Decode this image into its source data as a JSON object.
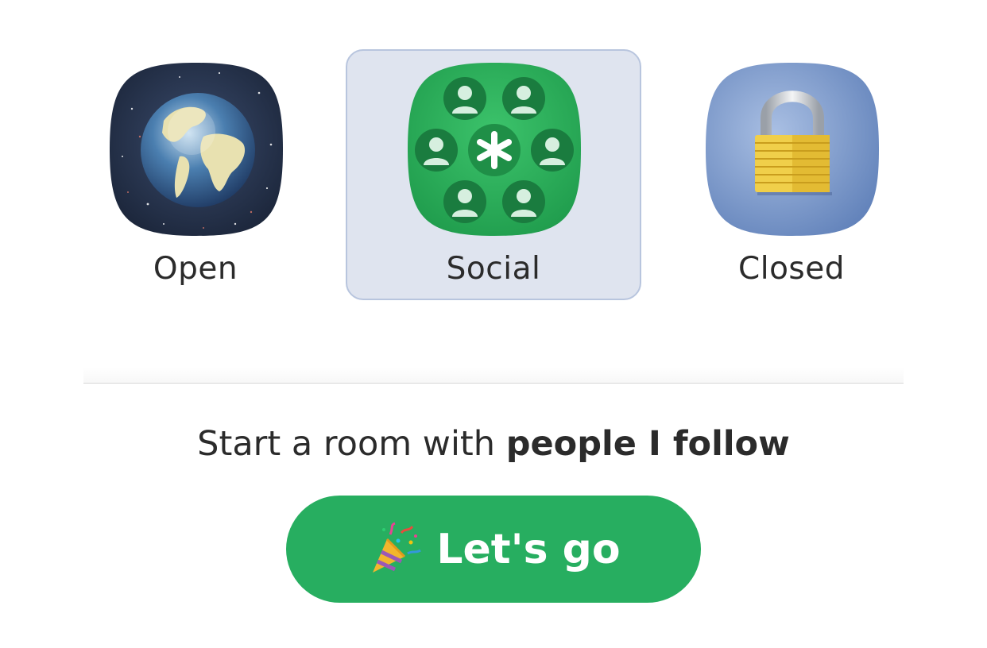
{
  "room_types": [
    {
      "id": "open",
      "label": "Open",
      "icon": "globe-icon",
      "selected": false
    },
    {
      "id": "social",
      "label": "Social",
      "icon": "social-group-icon",
      "selected": true
    },
    {
      "id": "closed",
      "label": "Closed",
      "icon": "padlock-icon",
      "selected": false
    }
  ],
  "prompt": {
    "prefix": "Start a room with ",
    "emphasis": "people I follow"
  },
  "go_button": {
    "label": "Let's go",
    "icon": "party-popper-icon",
    "color": "#27ae60"
  },
  "colors": {
    "selected_bg": "#dfe4ef",
    "selected_border": "#b8c5de"
  }
}
